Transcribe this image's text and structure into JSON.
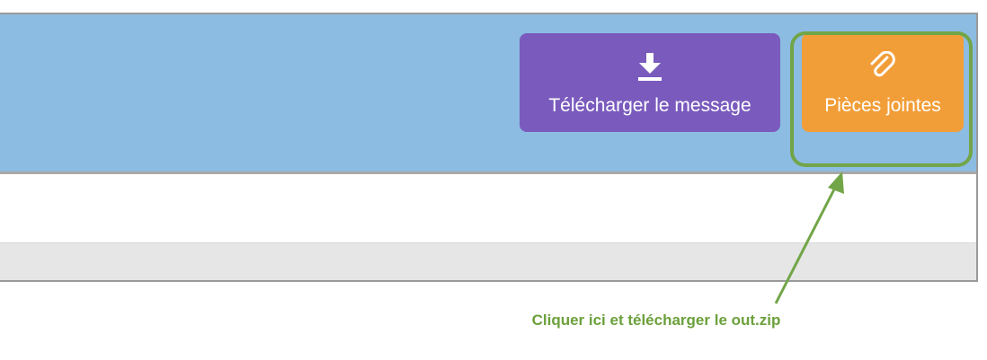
{
  "toolbar": {
    "download_label": "Télécharger le message",
    "download_icon": "download-icon",
    "download_color": "#7a5bbd",
    "attachments_label": "Pièces jointes",
    "attachments_icon": "paperclip-icon",
    "attachments_color": "#f29e38"
  },
  "annotation": {
    "text": "Cliquer ici et télécharger le out.zip",
    "color": "#6ba03b"
  },
  "theme": {
    "header_bg": "#8cbce2",
    "footer_bg": "#e6e6e6"
  }
}
